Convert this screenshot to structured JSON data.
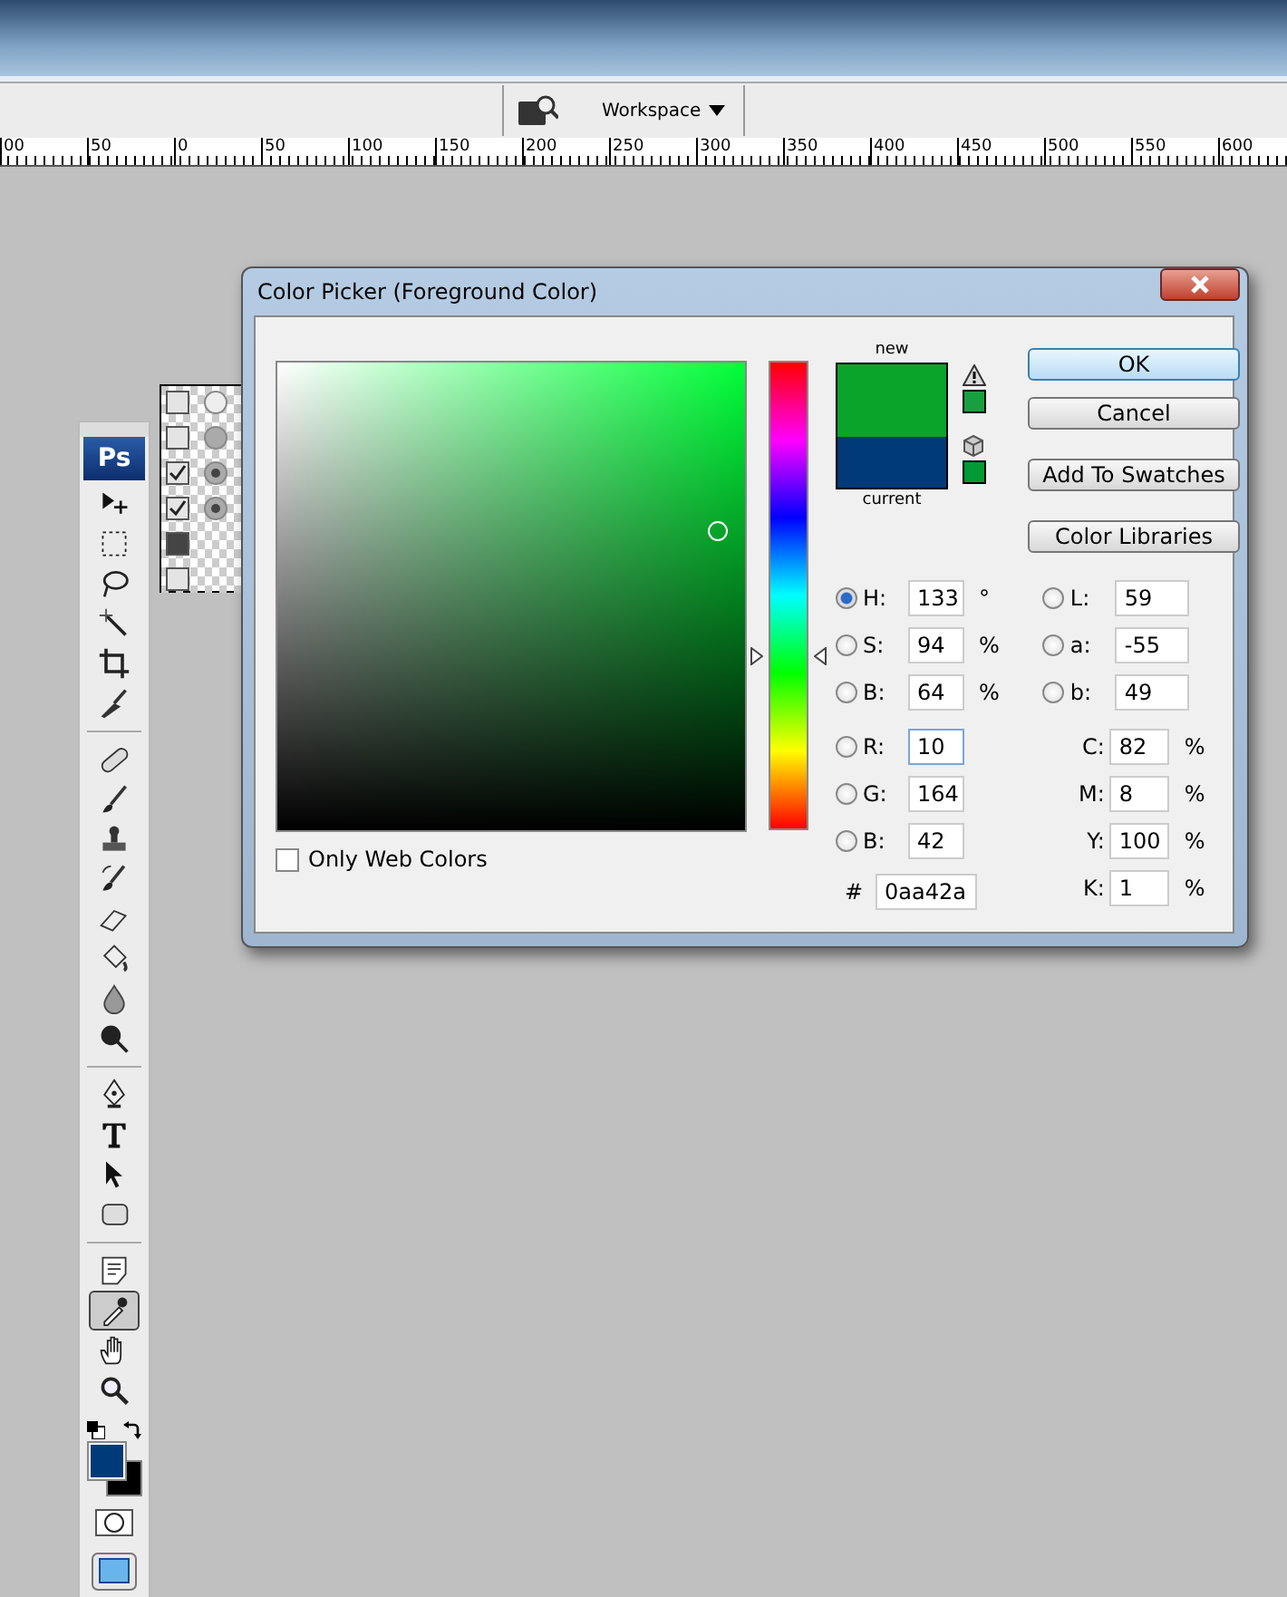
{
  "options_bar": {
    "workspace_label": "Workspace"
  },
  "ruler": {
    "labels": [
      "00",
      "50",
      "0",
      "50",
      "100",
      "150",
      "200",
      "250",
      "300",
      "350",
      "400",
      "450",
      "500",
      "550",
      "600"
    ]
  },
  "toolbox": {
    "logo": "Ps",
    "groups": [
      [
        {
          "kind": "move",
          "selected": false
        },
        {
          "kind": "marquee",
          "selected": false
        },
        {
          "kind": "lasso",
          "selected": false
        },
        {
          "kind": "wand",
          "selected": false
        },
        {
          "kind": "crop",
          "selected": false
        },
        {
          "kind": "knife",
          "selected": false
        }
      ],
      [
        {
          "kind": "bandage",
          "selected": false
        },
        {
          "kind": "brush",
          "selected": false
        },
        {
          "kind": "stamp",
          "selected": false
        },
        {
          "kind": "history",
          "selected": false
        },
        {
          "kind": "eraser",
          "selected": false
        },
        {
          "kind": "bucket",
          "selected": false
        },
        {
          "kind": "drop",
          "selected": false
        },
        {
          "kind": "dodge",
          "selected": false
        }
      ],
      [
        {
          "kind": "pen",
          "selected": false
        },
        {
          "kind": "type",
          "selected": false
        },
        {
          "kind": "arrow",
          "selected": false
        },
        {
          "kind": "shape",
          "selected": false
        }
      ],
      [
        {
          "kind": "note",
          "selected": false
        },
        {
          "kind": "eyedropper",
          "selected": true
        },
        {
          "kind": "hand",
          "selected": false
        },
        {
          "kind": "zoom",
          "selected": false
        }
      ]
    ]
  },
  "dialog": {
    "title": "Color Picker (Foreground Color)",
    "hue_slider": {
      "level": 0.37
    },
    "new_label": "new",
    "current_label": "current",
    "buttons": [
      {
        "label": "OK",
        "default": true
      },
      {
        "label": "Cancel",
        "default": false
      },
      {
        "label": "Add To Swatches",
        "default": false
      },
      {
        "label": "Color Libraries",
        "default": false
      }
    ],
    "only_web_colors": {
      "label": "Only Web Colors",
      "checked": false
    },
    "fields_left": [
      {
        "label": "H:",
        "value": "133",
        "unit": "°",
        "selected": true
      },
      {
        "label": "S:",
        "value": "94",
        "unit": "%",
        "selected": false
      },
      {
        "label": "B:",
        "value": "64",
        "unit": "%",
        "selected": false
      },
      {
        "label": "R:",
        "value": "10",
        "selected": false,
        "focused": true
      },
      {
        "label": "G:",
        "value": "164",
        "selected": false
      },
      {
        "label": "B:",
        "value": "42",
        "selected": false
      }
    ],
    "fields_lab": [
      {
        "label": "L:",
        "value": "59",
        "selected": false
      },
      {
        "label": "a:",
        "value": "-55",
        "selected": false
      },
      {
        "label": "b:",
        "value": "49",
        "selected": false
      }
    ],
    "fields_cmyk": [
      {
        "label": "C:",
        "value": "82",
        "unit": "%"
      },
      {
        "label": "M:",
        "value": "8",
        "unit": "%"
      },
      {
        "label": "Y:",
        "value": "100",
        "unit": "%"
      },
      {
        "label": "K:",
        "value": "1",
        "unit": "%"
      }
    ],
    "hex": {
      "label": "#",
      "value": "0aa42a"
    }
  }
}
